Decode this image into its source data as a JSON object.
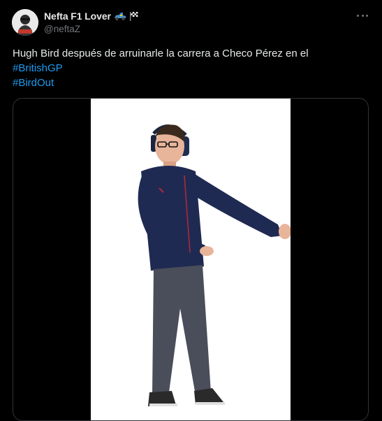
{
  "author": {
    "display_name": "Nefta F1 Lover",
    "handle": "@neftaZ",
    "emoji_icons": [
      "racing-car-emoji",
      "checkered-flag-emoji"
    ]
  },
  "tweet": {
    "text_line": "Hugh Bird después de arruinarle la carrera a Checo Pérez en el",
    "hashtags": [
      "#BritishGP",
      "#BirdOut"
    ]
  },
  "media": {
    "type": "video",
    "description_icon": "person-dancing-image"
  },
  "colors": {
    "background": "#000000",
    "text": "#e7e9ea",
    "secondary": "#71767b",
    "link": "#1d9bf0",
    "border": "#2f3336"
  }
}
